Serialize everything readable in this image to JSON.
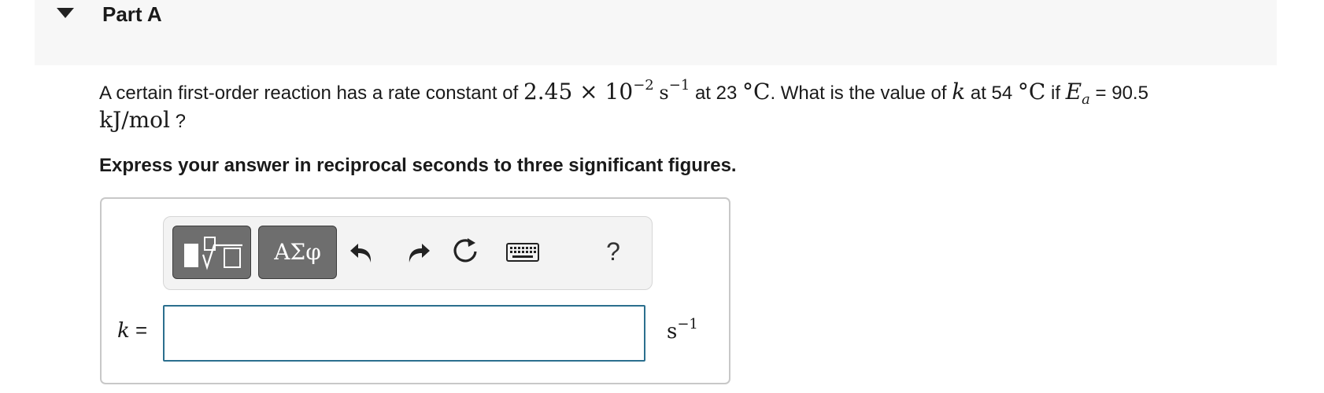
{
  "part": {
    "title": "Part A"
  },
  "question": {
    "t1": "A certain first-order reaction has a rate constant of ",
    "value": "2.45",
    "times": " × ",
    "base": "10",
    "exp": "−2",
    "unit_s": "s",
    "unit_exp": "−1",
    "t2": " at 23 ",
    "temp_unit": "°C",
    "t3": ". What is the value of ",
    "k": "k",
    "t4": " at 54 ",
    "t5": " if ",
    "E": "E",
    "a": "a",
    "t6": " = 90.5",
    "energy_unit": "kJ/mol",
    "t7": " ?"
  },
  "instruction": "Express your answer in reciprocal seconds to three significant figures.",
  "toolbar": {
    "symbols_label": "ΑΣφ",
    "help_label": "?",
    "icons": [
      "templates-icon",
      "greek-symbols-icon",
      "undo-icon",
      "redo-icon",
      "reset-icon",
      "keyboard-icon",
      "help-icon"
    ]
  },
  "answer": {
    "label_var": "k",
    "label_eq": " =",
    "value": "",
    "unit": "s",
    "unit_exp": "−1"
  }
}
